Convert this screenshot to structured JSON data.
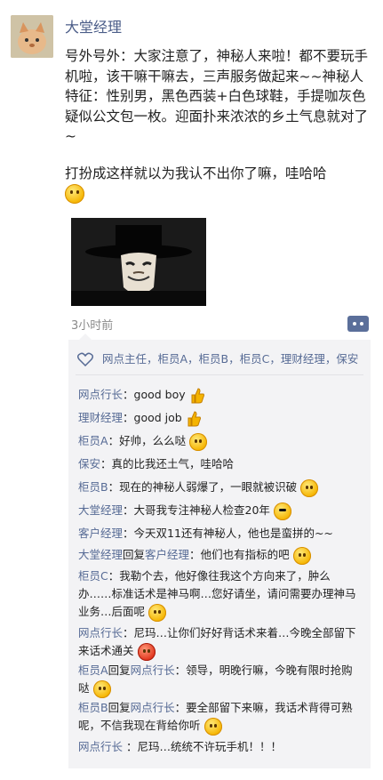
{
  "author": "大堂经理",
  "post": {
    "paragraph1": "号外号外：大家注意了，神秘人来啦！都不要玩手机啦，该干嘛干嘛去，三声服务做起来~~神秘人特征：性别男，黑色西装+白色球鞋，手提咖灰色疑似公文包一枚。迎面扑来浓浓的乡土气息就对了~",
    "paragraph2": "打扮成这样就以为我认不出你了嘛，哇哈哈"
  },
  "timestamp": "3小时前",
  "likes": "网点主任，柜员A，柜员B，柜员C，理财经理，保安",
  "comments": [
    {
      "name": "网点行长",
      "sep": "：",
      "text": "good boy",
      "icon": "thumbs-up-icon"
    },
    {
      "name": "理财经理",
      "sep": "：",
      "text": "good job",
      "icon": "thumbs-up-icon"
    },
    {
      "name": "柜员A",
      "sep": "：",
      "text": "好帅，么么哒",
      "icon": "blush-emoji-icon"
    },
    {
      "name": "保安",
      "sep": "：",
      "text": "真的比我还土气，哇哈哈",
      "icon": ""
    },
    {
      "name": "柜员B",
      "sep": "：",
      "text": "现在的神秘人弱爆了，一眼就被识破",
      "icon": "thinking-emoji-icon"
    },
    {
      "name": "大堂经理",
      "sep": "：",
      "text": "大哥我专注神秘人检查20年",
      "icon": "sunglasses-emoji-icon"
    },
    {
      "name": "客户经理",
      "sep": "：",
      "text": "今天双11还有神秘人，他也是蛮拼的~~",
      "icon": ""
    },
    {
      "name": "大堂经理",
      "reply_word": "回复",
      "reply_to": "客户经理",
      "sep": "：",
      "text": "他们也有指标的吧",
      "icon": "smirk-emoji-icon"
    },
    {
      "name": "柜员C",
      "sep": "：",
      "text": "我勒个去，他好像往我这个方向来了，肿么办……标准话术是神马啊…您好请坐，请问需要办理神马业务…后面呢",
      "icon": "laugh-emoji-icon"
    },
    {
      "name": "网点行长",
      "sep": "：",
      "text": "尼玛…让你们好好背话术来着…今晚全部留下来话术通关",
      "icon": "angry-emoji-icon"
    },
    {
      "name": "柜员A",
      "reply_word": "回复",
      "reply_to": "网点行长",
      "sep": "：",
      "text": "领导，明晚行嘛，今晚有限时抢购哒",
      "icon": "grin-emoji-icon"
    },
    {
      "name": "柜员B",
      "reply_word": "回复",
      "reply_to": "网点行长",
      "sep": "：",
      "text": "要全部留下来嘛，我话术背得可熟呢，不信我现在背给你听",
      "icon": "shy-emoji-icon"
    },
    {
      "name": "网点行长",
      "sep": " ：",
      "text": "尼玛…统统不许玩手机！！！",
      "icon": ""
    }
  ],
  "colors": {
    "link": "#576b95",
    "author": "#4b5d88",
    "comment_bg": "#f3f3f5"
  }
}
